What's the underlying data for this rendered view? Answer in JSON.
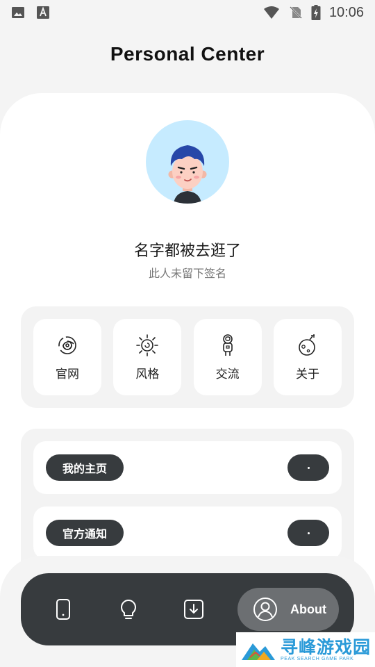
{
  "status_bar": {
    "time": "10:06",
    "left_icons": [
      "image-icon",
      "font-a-icon"
    ],
    "right_icons": [
      "wifi-icon",
      "no-sim-icon",
      "battery-charging-icon"
    ]
  },
  "header": {
    "title": "Personal Center"
  },
  "profile": {
    "avatar": "avatar-icon",
    "name": "名字都被去逛了",
    "signature": "此人未留下签名"
  },
  "shortcuts": [
    {
      "label": "官网",
      "icon": "spiral-icon"
    },
    {
      "label": "风格",
      "icon": "sun-swirl-icon"
    },
    {
      "label": "交流",
      "icon": "astronaut-icon"
    },
    {
      "label": "关于",
      "icon": "bomb-icon"
    }
  ],
  "list": [
    {
      "label": "我的主页"
    },
    {
      "label": "官方通知"
    }
  ],
  "nav": {
    "items": [
      "phone-icon",
      "lightbulb-icon",
      "download-icon"
    ],
    "active": {
      "icon": "user-circle-icon",
      "label": "About"
    }
  },
  "watermark": {
    "main": "寻峰游戏园",
    "sub": "PEAK SEARCH GAME PARK"
  },
  "colors": {
    "background": "#f4f4f4",
    "card": "#ffffff",
    "dark": "#373b3e",
    "avatar_bg": "#c6ebff",
    "nav_active": "#6c6f72"
  }
}
